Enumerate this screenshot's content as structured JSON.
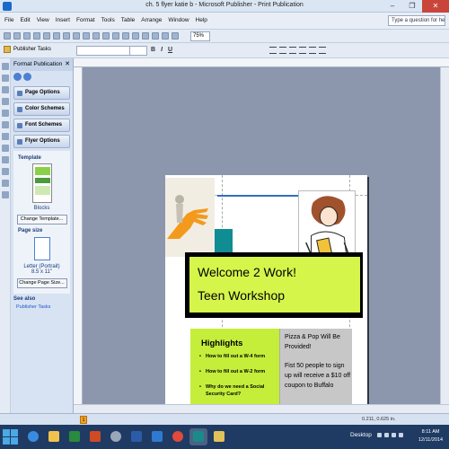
{
  "window": {
    "title": "ch. 5 flyer katie b - Microsoft Publisher - Print Publication",
    "minimize": "–",
    "maximize": "❐",
    "close": "✕"
  },
  "menu": {
    "items": [
      "File",
      "Edit",
      "View",
      "Insert",
      "Format",
      "Tools",
      "Table",
      "Arrange",
      "Window",
      "Help"
    ],
    "help_placeholder": "Type a question for help"
  },
  "toolbar": {
    "zoom": "75%",
    "publisher_tasks": "Publisher Tasks",
    "bold": "B",
    "italic": "I",
    "underline": "U"
  },
  "task_pane": {
    "title": "Format Publication",
    "close": "✕",
    "sections": [
      "Page Options",
      "Color Schemes",
      "Font Schemes",
      "Flyer Options"
    ],
    "template_label": "Template",
    "template_name": "Blocks",
    "change_template": "Change Template...",
    "page_size_label": "Page size",
    "page_size_name": "Letter (Portrait)",
    "page_size_dims": "8.5 x 11\"",
    "change_page_size": "Change Page Size...",
    "see_also": "See also",
    "publisher_tasks_link": "Publisher Tasks"
  },
  "flyer": {
    "title_line1": "Welcome 2 Work!",
    "title_line2": "Teen Workshop",
    "highlights_title": "Highlights",
    "highlights": [
      "How to fill out a W-4 form",
      "How to fill out a W-2 form",
      "Why do we need a Social Security Card?"
    ],
    "info_line1": "Pizza & Pop Will Be Provided!",
    "info_line2": "Fist 50 people to sign up will receive a $10 off coupon to Buffalo",
    "colors": {
      "lime": "#c5ee3a",
      "title_bg": "#d6f54b",
      "teal": "#0f8d92",
      "orange": "#f39a1d"
    }
  },
  "status": {
    "page_number": "1",
    "coords": "0.211, 0.625 in."
  },
  "taskbar": {
    "desktop": "Desktop",
    "time": "8:11 AM",
    "date": "12/11/2014"
  }
}
